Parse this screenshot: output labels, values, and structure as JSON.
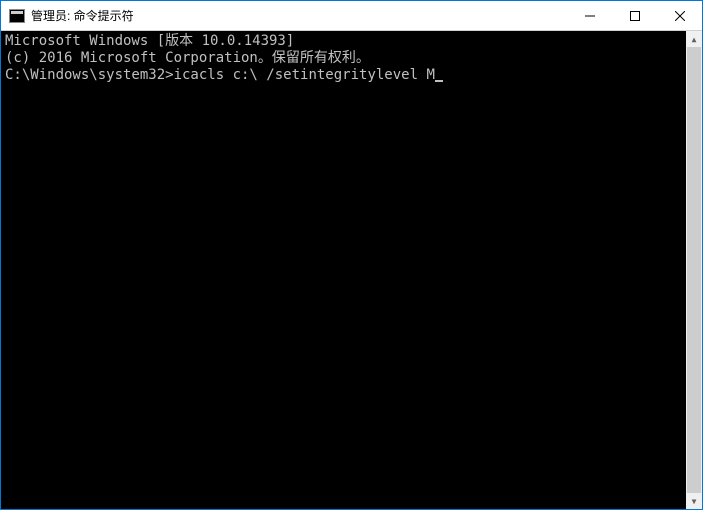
{
  "window": {
    "title": "管理员: 命令提示符"
  },
  "terminal": {
    "line1": "Microsoft Windows [版本 10.0.14393]",
    "line2": "(c) 2016 Microsoft Corporation。保留所有权利。",
    "line3": "",
    "prompt": "C:\\Windows\\system32>",
    "command": "icacls c:\\ /setintegritylevel M"
  }
}
